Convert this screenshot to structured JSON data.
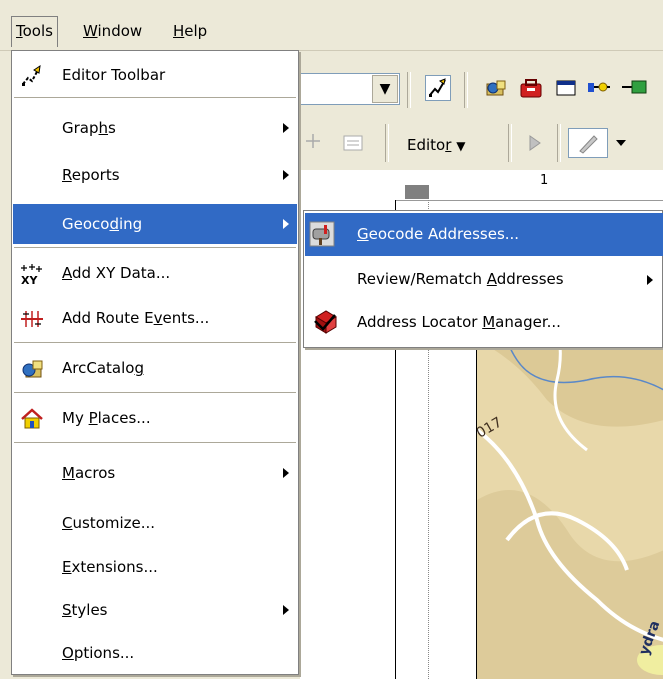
{
  "menubar": {
    "tools": "Tools",
    "window": "Window",
    "help": "Help"
  },
  "tools_menu": {
    "editor_toolbar": "Editor Toolbar",
    "graphs": "Graphs",
    "reports": "Reports",
    "geocoding": "Geocoding",
    "add_xy_data": "Add XY Data...",
    "add_route_events": "Add Route Events...",
    "arccatalog": "ArcCatalog",
    "my_places": "My Places...",
    "macros": "Macros",
    "customize": "Customize...",
    "extensions": "Extensions...",
    "styles": "Styles",
    "options": "Options..."
  },
  "geocoding_submenu": {
    "geocode_addresses": "Geocode Addresses...",
    "review_rematch": "Review/Rematch Addresses",
    "address_locator_manager": "Address Locator Manager..."
  },
  "toolbar": {
    "editor_label": "Editor",
    "ruler_label": "1"
  },
  "map": {
    "label_road": "017",
    "label_hydra": "ydra"
  },
  "colors": {
    "menu_highlight": "#316ac5",
    "menu_background": "#ffffff",
    "chrome": "#ece9d8",
    "map_terrain": "#e6d7a8"
  }
}
